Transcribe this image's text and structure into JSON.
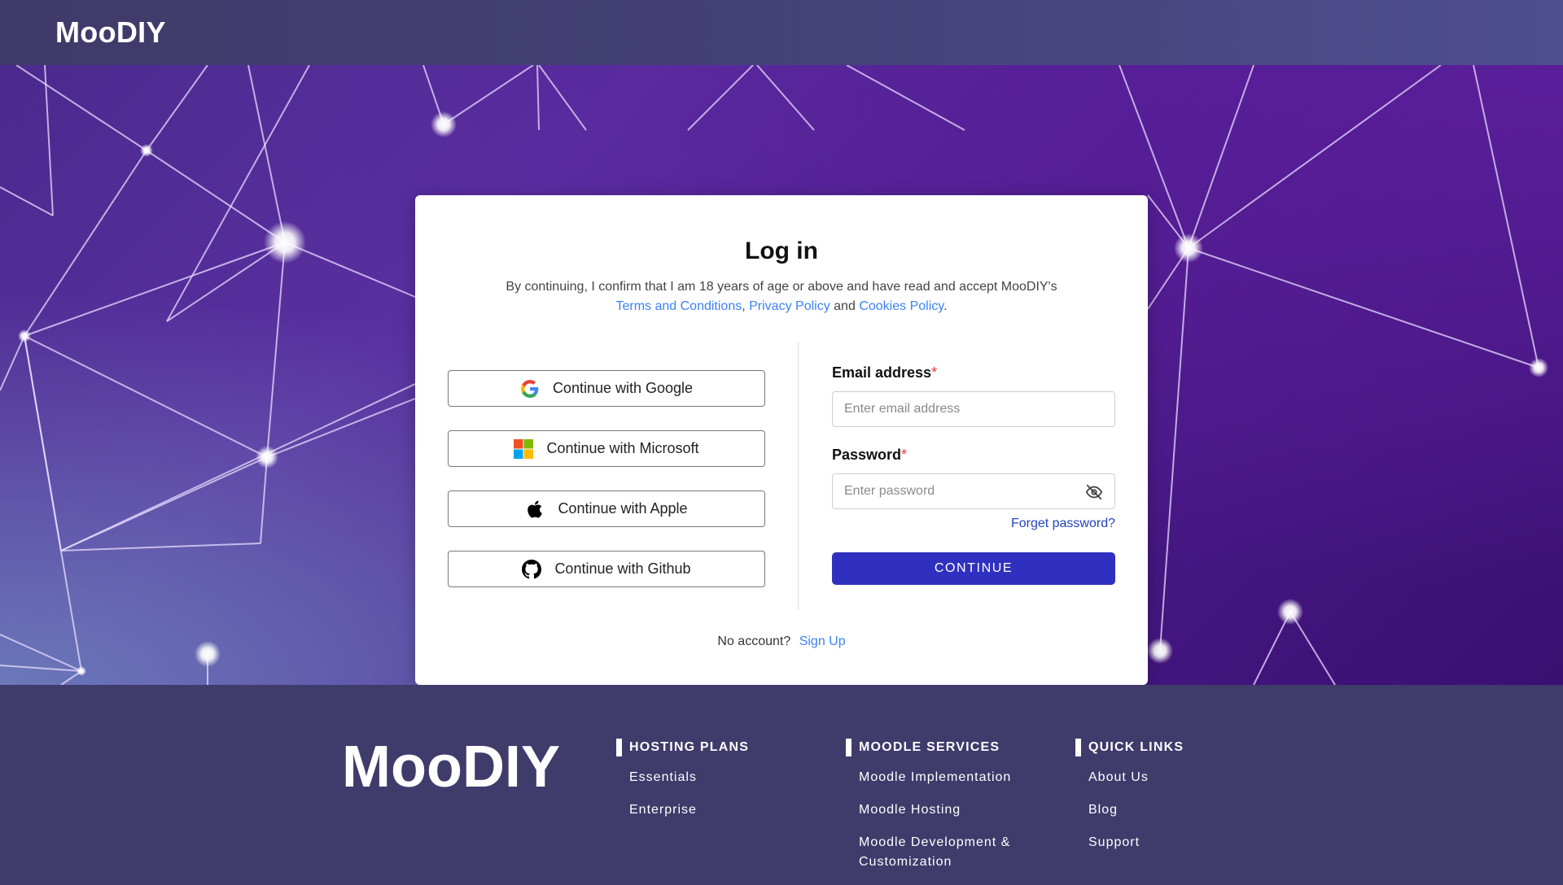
{
  "header": {
    "brand": "MooDIY"
  },
  "login": {
    "title": "Log in",
    "legal_prefix": "By continuing, I confirm that I am 18 years of age or above and have read and accept MooDIY's",
    "terms_link": "Terms and Conditions",
    "comma": ",",
    "privacy_link": "Privacy Policy",
    "and": "and",
    "cookies_link": "Cookies Policy",
    "period": ".",
    "social": [
      {
        "label": "Continue with Google",
        "icon": "google-icon"
      },
      {
        "label": "Continue with Microsoft",
        "icon": "microsoft-icon"
      },
      {
        "label": "Continue with Apple",
        "icon": "apple-icon"
      },
      {
        "label": "Continue with Github",
        "icon": "github-icon"
      }
    ],
    "email_label": "Email address",
    "email_placeholder": "Enter email address",
    "email_value": "",
    "password_label": "Password",
    "password_placeholder": "Enter password",
    "password_value": "",
    "required_mark": "*",
    "forgot": "Forget password?",
    "continue": "CONTINUE",
    "no_account": "No account?",
    "signup": "Sign Up"
  },
  "footer": {
    "logo": "MooDIY",
    "columns": [
      {
        "title": "HOSTING PLANS",
        "links": [
          "Essentials",
          "Enterprise"
        ]
      },
      {
        "title": "MOODLE SERVICES",
        "links": [
          "Moodle Implementation",
          "Moodle Hosting",
          "Moodle Development & Customization"
        ]
      },
      {
        "title": "QUICK LINKS",
        "links": [
          "About Us",
          "Blog",
          "Support"
        ]
      }
    ]
  },
  "colors": {
    "primary_button": "#3030c0",
    "link": "#3b82f6",
    "forgot_link": "#2444b8",
    "required": "#e53935",
    "header_bg": "#3f3a68",
    "footer_bg": "#3f3b6b"
  }
}
